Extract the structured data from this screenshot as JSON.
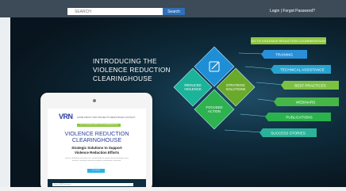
{
  "search": {
    "placeholder": "SEARCH",
    "button_label": "Search"
  },
  "account": {
    "login_label": "Login",
    "separator": " | ",
    "forgot_label": "Forgot Password?"
  },
  "hero": {
    "title_lines": [
      "INTRODUCING THE",
      "VIOLENCE REDUCTION",
      "CLEARINGHOUSE"
    ],
    "cta_label": "GO TO VIOLENCE REDUCTION CLEARINGHOUSE"
  },
  "diagram": {
    "center_icon": "edit-icon",
    "diamonds": [
      {
        "label_lines": [
          "REDUCED",
          "VIOLENCE"
        ],
        "color": "#1bb39a"
      },
      {
        "label_lines": [
          "STRATEGIC",
          "SOLUTIONS"
        ],
        "color": "#6aaa2a"
      },
      {
        "label_lines": [
          "FOCUSED",
          "ACTION"
        ],
        "color": "#2db24f"
      }
    ],
    "top_diamond_color": "#1e8fd6",
    "links": [
      {
        "label": "TRAINING",
        "color": "#2a8fd9"
      },
      {
        "label": "TECHNICAL ASSISTANCE",
        "color": "#27a3cf"
      },
      {
        "label": "BEST PRACTICES",
        "color": "#7cc242"
      },
      {
        "label": "WEBINARS",
        "color": "#47b649"
      },
      {
        "label": "PUBLICATIONS",
        "color": "#2bb24d"
      },
      {
        "label": "SUCCESS STORIES",
        "color": "#2bb39a"
      }
    ]
  },
  "tablet": {
    "logo": "VRN",
    "nav_items": "HOME  ABOUT  VRN  PROJECTS  RESOURCES  CONTACT",
    "cta_label": "GO TO VIOLENCE REDUCTION CLEARINGHOUSE",
    "title_lines": [
      "VIOLENCE REDUCTION",
      "CLEARINGHOUSE"
    ],
    "subtitle_lines": [
      "Strategic Solutions to Support",
      "Violence Reduction Efforts"
    ],
    "body": "Search, download, and share our curated toolkit of violence-based strategies, best practices, training, technical assistance, publications, and more.",
    "button_label": "Get started",
    "search_placeholder": "Search VRN Resources"
  }
}
